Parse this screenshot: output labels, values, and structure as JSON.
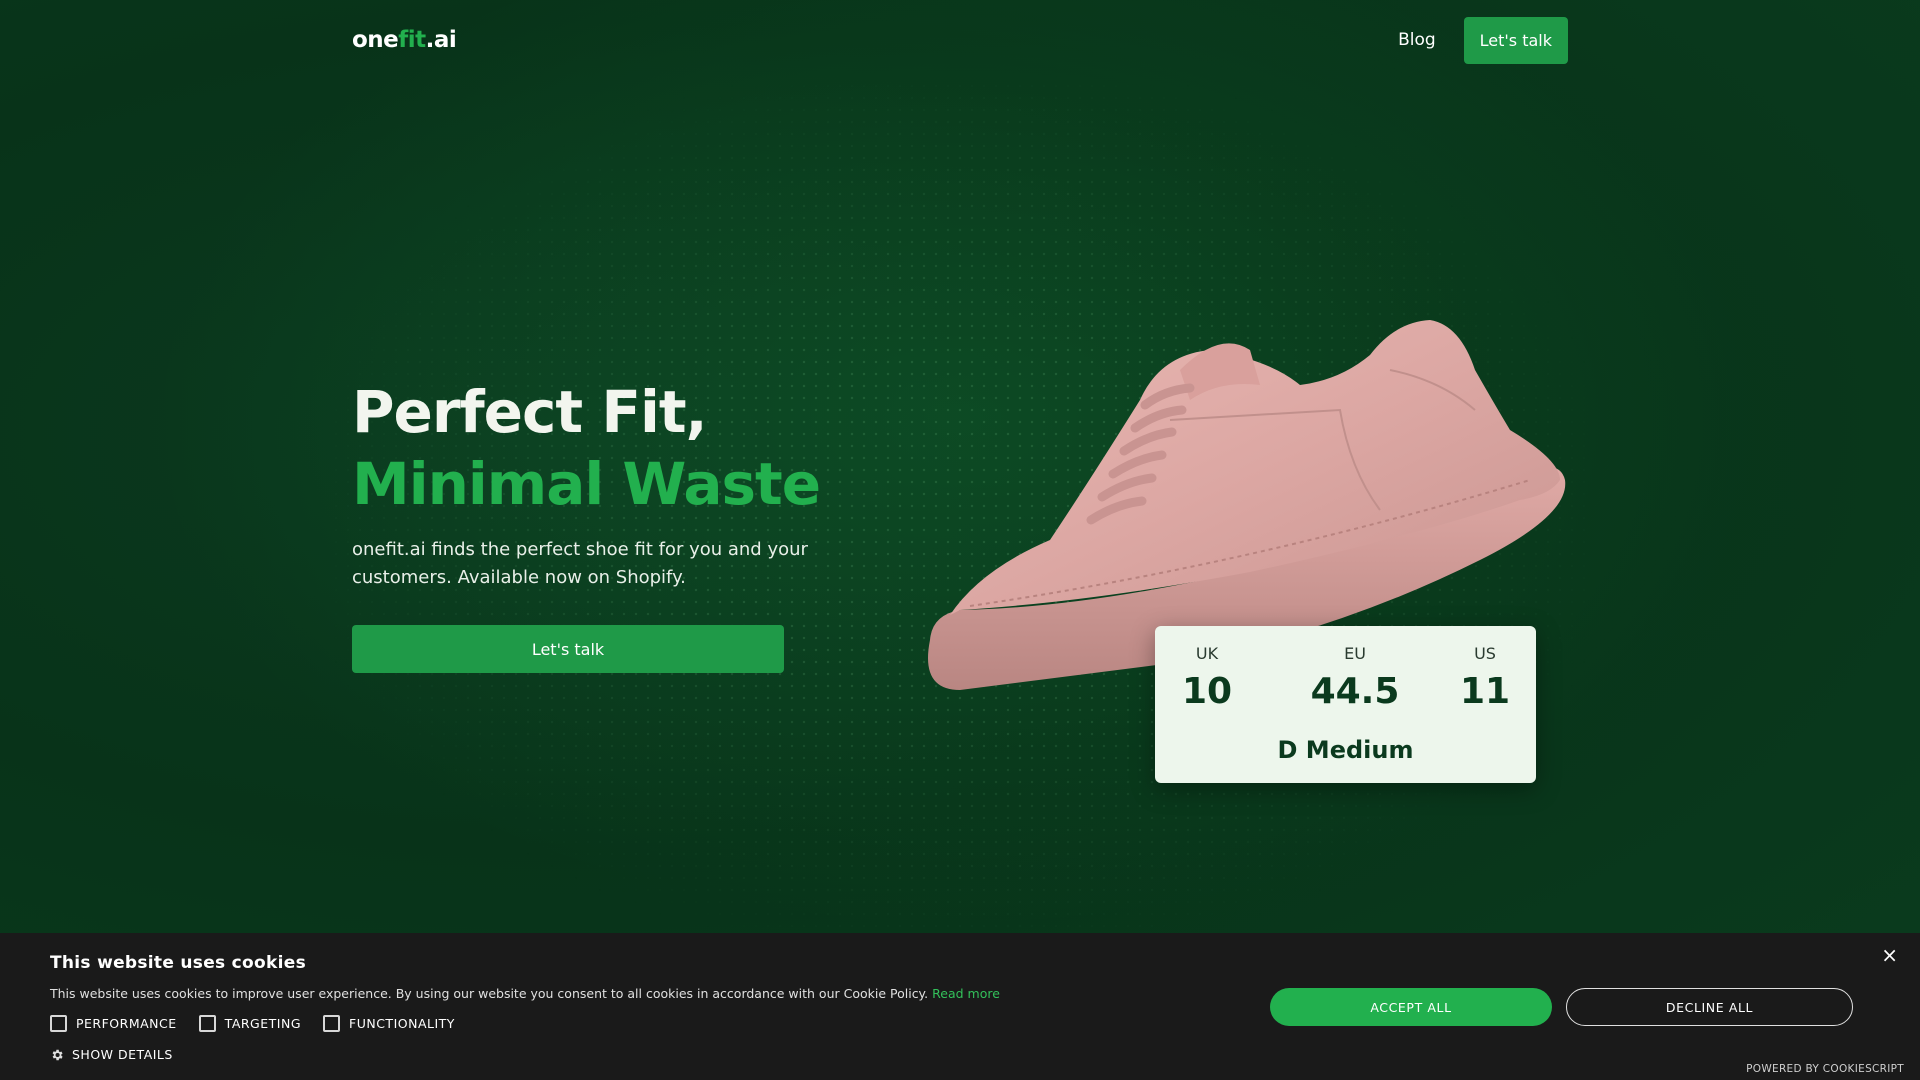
{
  "nav": {
    "logo_one": "one",
    "logo_fit": "fit",
    "logo_ai": ".ai",
    "blog": "Blog",
    "cta": "Let's talk"
  },
  "hero": {
    "title_line1": "Perfect Fit,",
    "title_line2": "Minimal Waste",
    "subtitle": "onefit.ai finds the perfect shoe fit for you and your customers. Available now on Shopify.",
    "cta": "Let's talk"
  },
  "size_card": {
    "uk_label": "UK",
    "uk_value": "10",
    "eu_label": "EU",
    "eu_value": "44.5",
    "us_label": "US",
    "us_value": "11",
    "width": "D Medium"
  },
  "cookie": {
    "title": "This website uses cookies",
    "text": "This website uses cookies to improve user experience. By using our website you consent to all cookies in accordance with our Cookie Policy.",
    "read_more": "Read more",
    "checks": {
      "performance": "PERFORMANCE",
      "targeting": "TARGETING",
      "functionality": "FUNCTIONALITY"
    },
    "show_details": "SHOW DETAILS",
    "accept": "ACCEPT ALL",
    "decline": "DECLINE ALL",
    "close": "×",
    "powered": "POWERED BY COOKIESCRIPT"
  },
  "colors": {
    "accent": "#22b04e",
    "button": "#1f9a48",
    "background": "#083319",
    "card": "#edf6ec",
    "banner": "#1a1a1a"
  },
  "icons": [
    "gear-icon",
    "close-icon",
    "shoe-image"
  ]
}
